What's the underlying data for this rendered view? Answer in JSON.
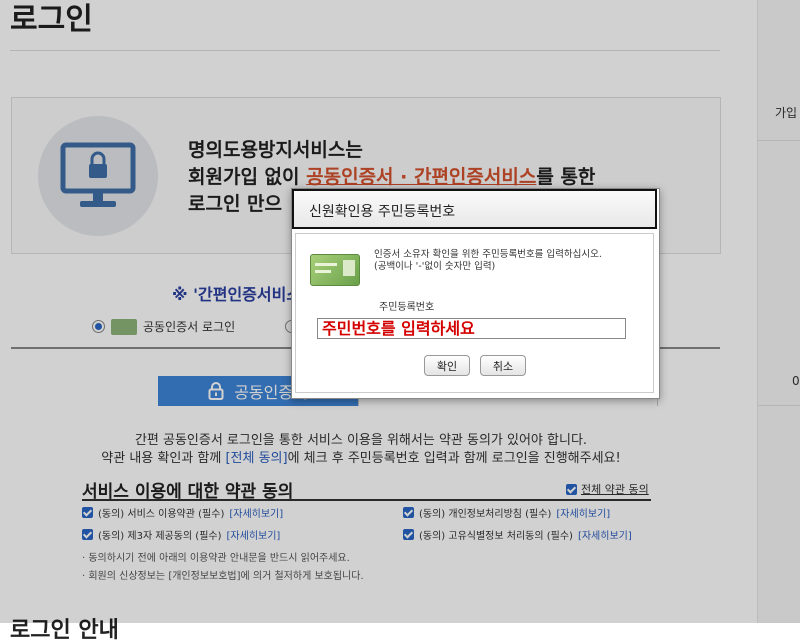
{
  "page": {
    "title": "로그인"
  },
  "right_panel": {
    "label1": "가입",
    "label2": "0"
  },
  "notice": {
    "line1": "명의도용방지서비스는",
    "line2_pre": "회원가입 없이 ",
    "line2_highlight": "공동인증서 · 간편인증서비스",
    "line2_post": "를 통한",
    "line3": "로그인 만으"
  },
  "easy_heading": "※ '간편인증서비스",
  "auth_options": {
    "cert_label": "공동인증서 로그인"
  },
  "tabs": {
    "cert_tab": "공동인증서"
  },
  "description": {
    "line1": "간편 공동인증서 로그인을 통한 서비스 이용을 위해서는 약관 동의가 있어야 합니다.",
    "line2_pre": "약관 내용 확인과 함께 ",
    "line2_link": "[전체 동의]",
    "line2_post": "에 체크 후 주민등록번호 입력과 함께 로그인을 진행해주세요!"
  },
  "terms": {
    "title": "서비스 이용에 대한 약관 동의",
    "all_agree": "전체 약관 동의",
    "detail_link": "[자세히보기]",
    "items": [
      {
        "label": "(동의) 서비스 이용약관 (필수)"
      },
      {
        "label": "(동의) 개인정보처리방침 (필수)"
      },
      {
        "label": "(동의) 제3자 제공동의 (필수)"
      },
      {
        "label": "(동의) 고유식별정보 처리동의 (필수)"
      }
    ],
    "notes": [
      "· 동의하시기 전에 아래의 이용약관 안내문을 반드시 읽어주세요.",
      "· 회원의 신상정보는 [개인정보보호법]에 의거 철저하게 보호됩니다."
    ]
  },
  "next_section": {
    "heading": "로그인 안내"
  },
  "dialog": {
    "title": "신원확인용 주민등록번호",
    "message_line1": "인증서 소유자 확인을 위한 주민등록번호를 입력하십시오.",
    "message_line2": "(공백이나 '-'없이 숫자만 입력)",
    "field_label": "주민등록번호",
    "input_placeholder": "주민번호를 입력하세요",
    "input_value": "",
    "confirm_label": "확인",
    "cancel_label": "취소"
  },
  "colors": {
    "accent": "#3f86d8",
    "highlight": "#d4502c",
    "link": "#2a5dbf",
    "input_text": "#d40000"
  },
  "icons": [
    "monitor-lock-icon",
    "lock-icon",
    "cert-card-icon",
    "checkbox-checked-icon",
    "radio-selected-icon"
  ]
}
